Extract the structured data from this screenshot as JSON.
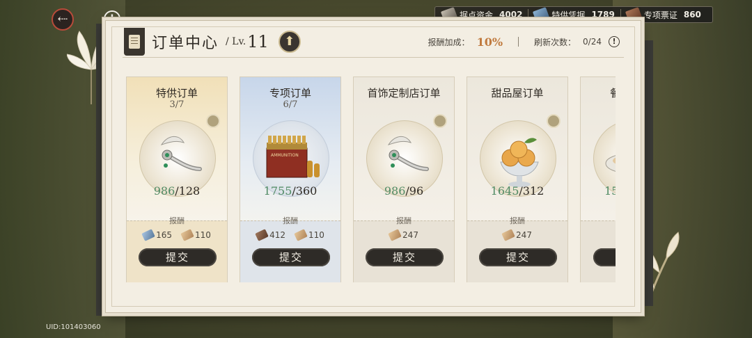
{
  "top": {
    "back_icon": "back-arrow-icon",
    "info_icon": "info-icon"
  },
  "currencies": [
    {
      "name": "据点资金",
      "value": "4002",
      "icon": "coins-icon"
    },
    {
      "name": "特供凭据",
      "value": "1789",
      "icon": "voucher-icon"
    },
    {
      "name": "专项票证",
      "value": "860",
      "icon": "ticket-icon"
    }
  ],
  "header": {
    "title": "订单中心",
    "lv_prefix": "/ Lv.",
    "lv_value": "11",
    "bonus_label": "报酬加成：",
    "bonus_value": "10%",
    "refresh_label": "刷新次数：",
    "refresh_value": "0/24"
  },
  "cards": [
    {
      "title": "特供订单",
      "count": "3/7",
      "have": "986",
      "need": "/128",
      "reward_label": "报酬",
      "rewards": [
        {
          "icon": "voucher-icon",
          "value": "165"
        },
        {
          "icon": "ticket-icon",
          "value": "110"
        }
      ],
      "button": "提交",
      "item_icon": "scepter-icon",
      "style": "gold"
    },
    {
      "title": "专项订单",
      "count": "6/7",
      "have": "1755",
      "need": "/360",
      "reward_label": "报酬",
      "rewards": [
        {
          "icon": "cash-icon",
          "value": "412"
        },
        {
          "icon": "ticket-icon",
          "value": "110"
        }
      ],
      "button": "提交",
      "item_icon": "ammunition-box-icon",
      "style": "blue",
      "item_text": "AMMUNITION"
    },
    {
      "title": "首饰定制店订单",
      "count": "",
      "have": "986",
      "need": "/96",
      "reward_label": "报酬",
      "rewards": [
        {
          "icon": "ticket-icon",
          "value": "247"
        }
      ],
      "button": "提交",
      "item_icon": "scepter-icon",
      "style": "plain"
    },
    {
      "title": "甜品屋订单",
      "count": "",
      "have": "1645",
      "need": "/312",
      "reward_label": "报酬",
      "rewards": [
        {
          "icon": "ticket-icon",
          "value": "247"
        }
      ],
      "button": "提交",
      "item_icon": "ice-cream-icon",
      "style": "plain"
    },
    {
      "title": "餐",
      "count": "",
      "have": "15",
      "need": "",
      "reward_label": "",
      "rewards": [],
      "button": "",
      "item_icon": "dish-icon",
      "style": "plain"
    }
  ],
  "uid": "UID:101403060",
  "colors": {
    "accent_orange": "#c07a3e",
    "progress_green": "#4f8a63",
    "button_dark": "#2e2b27"
  }
}
